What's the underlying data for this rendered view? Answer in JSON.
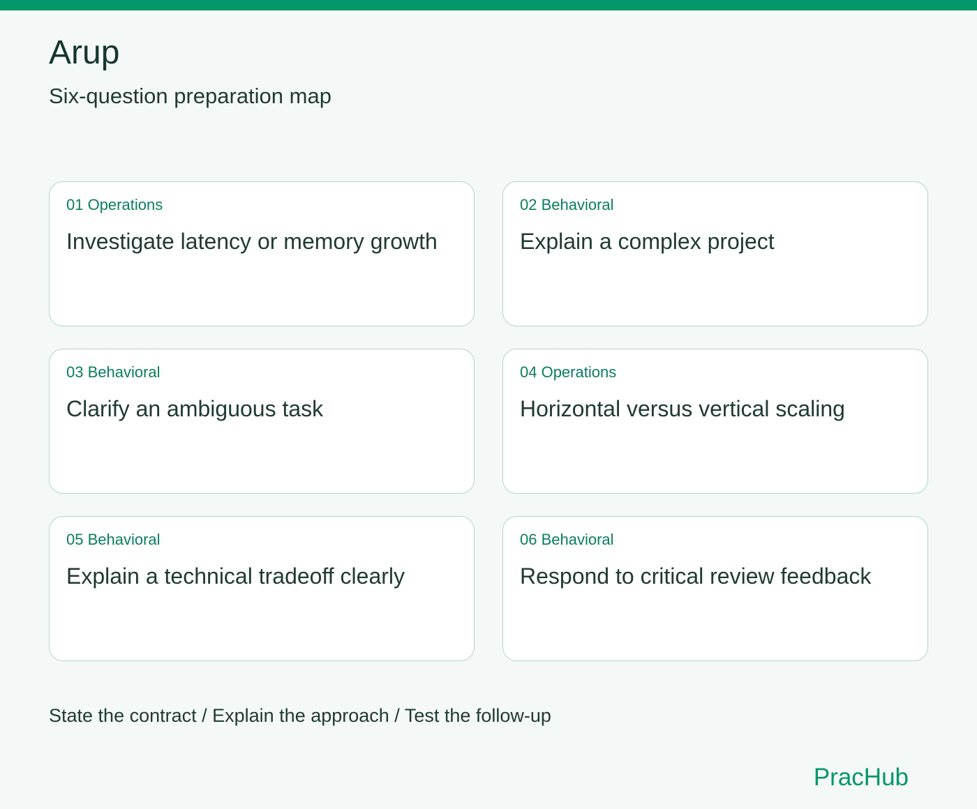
{
  "header": {
    "title": "Arup",
    "subtitle": "Six-question preparation map"
  },
  "cards": [
    {
      "tag": "01 Operations",
      "title": "Investigate latency or memory growth"
    },
    {
      "tag": "02 Behavioral",
      "title": "Explain a complex project"
    },
    {
      "tag": "03 Behavioral",
      "title": "Clarify an ambiguous task"
    },
    {
      "tag": "04 Operations",
      "title": "Horizontal versus vertical scaling"
    },
    {
      "tag": "05 Behavioral",
      "title": "Explain a technical tradeoff clearly"
    },
    {
      "tag": "06 Behavioral",
      "title": "Respond to critical review feedback"
    }
  ],
  "footer": {
    "note": "State the contract / Explain the approach / Test the follow-up",
    "brand": "PracHub"
  },
  "colors": {
    "accent": "#04976b",
    "background": "#f4f8f6",
    "card_border": "#b5d6cb",
    "tag_text": "#0a7e5c",
    "body_text": "#1f3a33"
  }
}
